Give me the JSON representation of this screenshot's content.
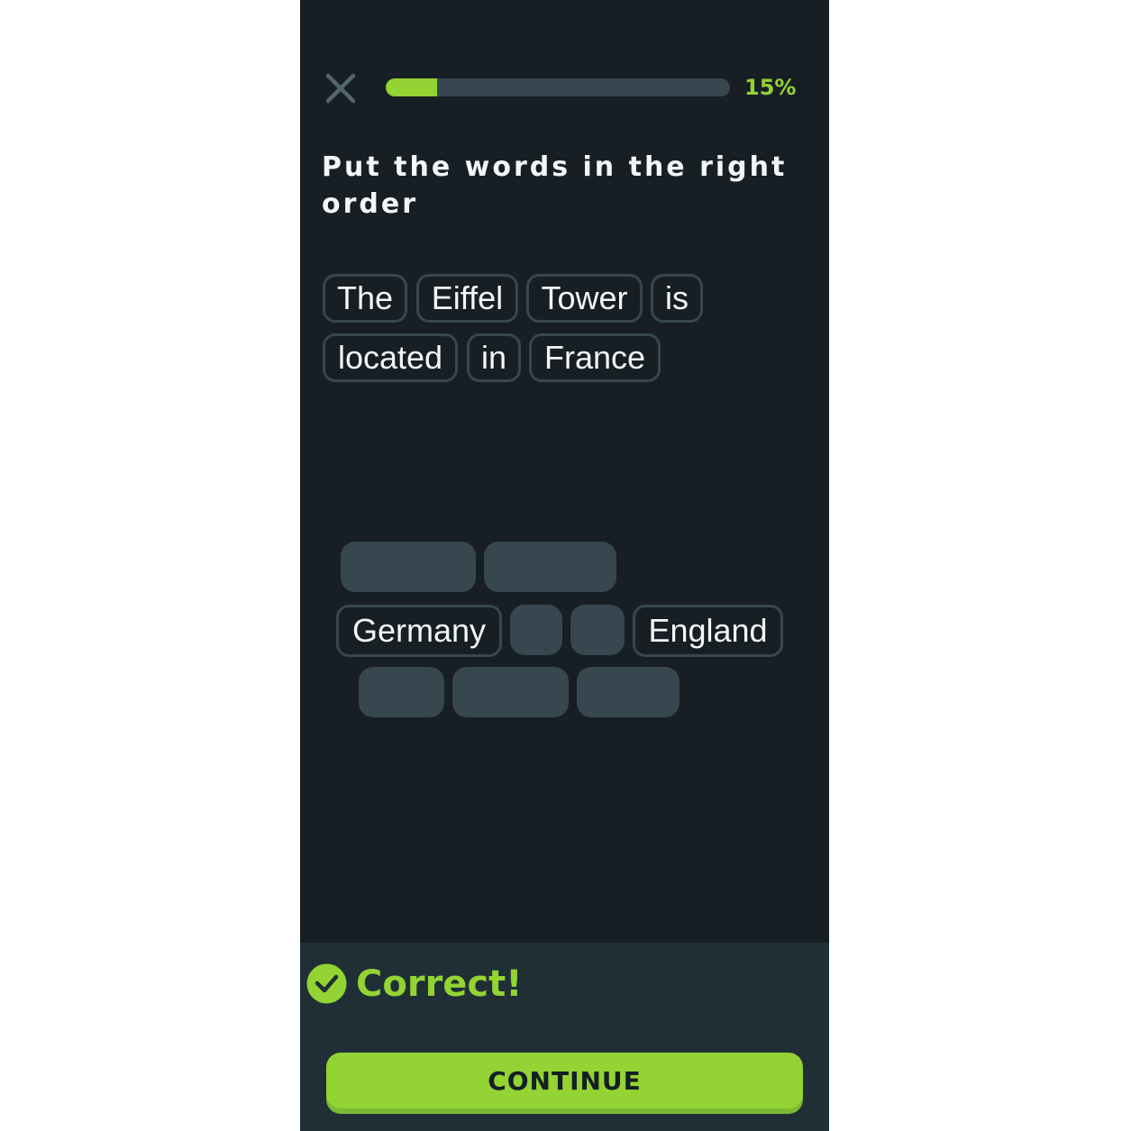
{
  "header": {
    "close_icon": "close-icon",
    "progress_percent": 15,
    "progress_label": "15%"
  },
  "instruction": "Put the words in the right order",
  "answer_words": [
    "The",
    "Eiffel",
    "Tower",
    "is",
    "located",
    "in",
    "France"
  ],
  "word_bank": {
    "remaining_words": [
      "Germany",
      "England"
    ],
    "used_slot_count": 7
  },
  "feedback": {
    "icon": "check-circle-icon",
    "text": "Correct!"
  },
  "continue_label": "CONTINUE",
  "colors": {
    "background": "#171f24",
    "accent": "#93d333",
    "chip_border": "#37464f",
    "footer": "#202f36"
  }
}
